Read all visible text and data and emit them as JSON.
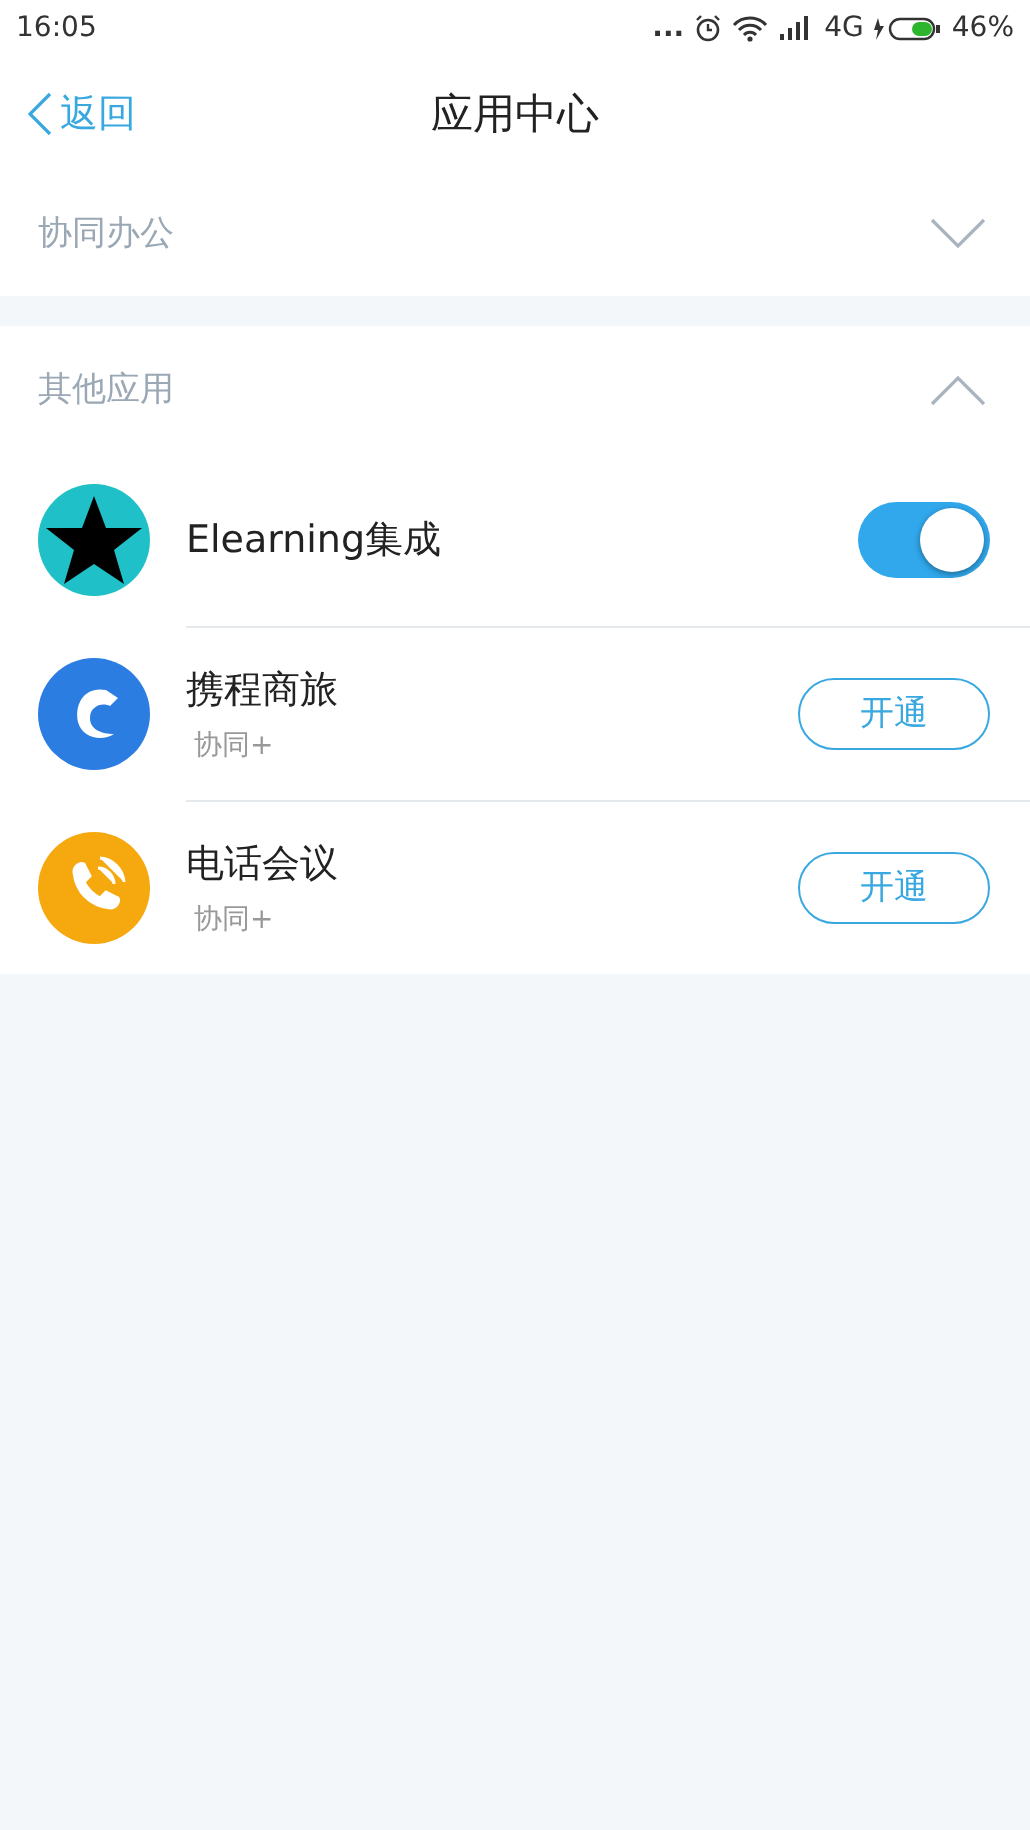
{
  "status_bar": {
    "time": "16:05",
    "dots": "...",
    "network": "4G",
    "battery": "46%"
  },
  "nav": {
    "back": "返回",
    "title": "应用中心"
  },
  "sections": [
    {
      "title": "协同办公",
      "expanded": false
    },
    {
      "title": "其他应用",
      "expanded": true,
      "apps": [
        {
          "name": "Elearning集成",
          "kind": "toggle",
          "on": true,
          "color": "#1fc0c8"
        },
        {
          "name": "携程商旅",
          "kind": "button",
          "subtitle": "协同+",
          "action": "开通",
          "color": "#2b7de1"
        },
        {
          "name": "电话会议",
          "kind": "button",
          "subtitle": "协同+",
          "action": "开通",
          "color": "#f5a90f"
        }
      ]
    }
  ]
}
